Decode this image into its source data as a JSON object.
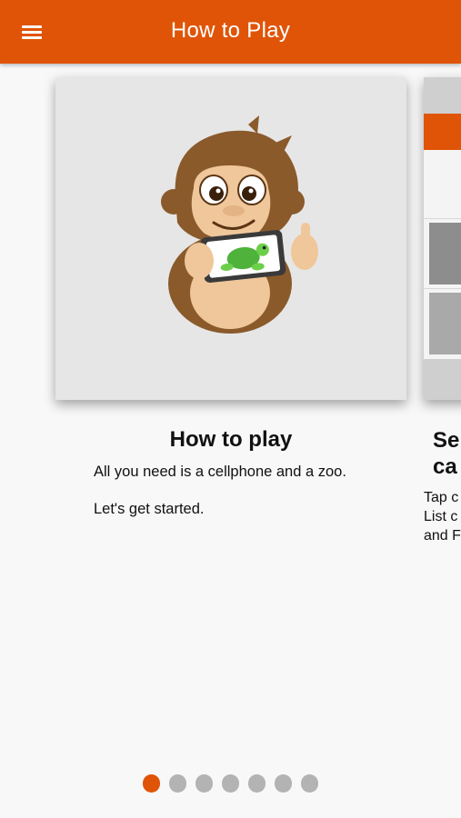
{
  "app_bar": {
    "title": "How to Play",
    "menu_icon": "hamburger-menu-icon",
    "background_color": "#e05408"
  },
  "slides": [
    {
      "title": "How to play",
      "lines": [
        "All you need is a cellphone and a zoo.",
        "Let's get started."
      ],
      "image": "monkey-holding-phone-with-turtle-illustration"
    },
    {
      "title_partial": "Se\nca",
      "lines_partial": [
        "Tap c",
        "List c",
        "and F"
      ],
      "image": "app-screen-preview"
    }
  ],
  "pager": {
    "total": 7,
    "current_index": 0,
    "active_color": "#e05408",
    "inactive_color": "#b3b3b3"
  }
}
